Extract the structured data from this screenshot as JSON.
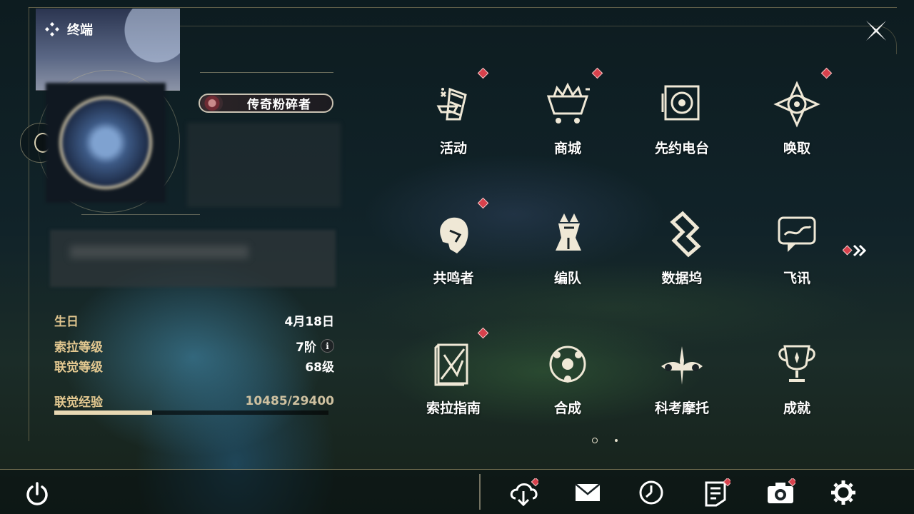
{
  "header": {
    "title": "终端"
  },
  "profile": {
    "title_badge": "传奇粉碎者",
    "stats": [
      {
        "label": "生日",
        "value": "4月18日"
      },
      {
        "label": "索拉等级",
        "value": "7阶"
      },
      {
        "label": "联觉等级",
        "value": "68级"
      }
    ],
    "exp": {
      "label": "联觉经验",
      "value": "10485/29400",
      "current": 10485,
      "max": 29400
    }
  },
  "menu": {
    "items": [
      {
        "label": "活动",
        "icon": "activity-icon",
        "badge": true
      },
      {
        "label": "商城",
        "icon": "shop-cart-icon",
        "badge": true
      },
      {
        "label": "先约电台",
        "icon": "radio-icon",
        "badge": false
      },
      {
        "label": "唤取",
        "icon": "summon-compass-icon",
        "badge": true
      },
      {
        "label": "共鸣者",
        "icon": "resonator-head-icon",
        "badge": true
      },
      {
        "label": "编队",
        "icon": "chess-formation-icon",
        "badge": false
      },
      {
        "label": "数据坞",
        "icon": "data-dock-icon",
        "badge": false
      },
      {
        "label": "飞讯",
        "icon": "message-bubble-icon",
        "badge": false
      },
      {
        "label": "索拉指南",
        "icon": "guide-book-icon",
        "badge": true
      },
      {
        "label": "合成",
        "icon": "synthesis-icon",
        "badge": false
      },
      {
        "label": "科考摩托",
        "icon": "motorcycle-icon",
        "badge": false
      },
      {
        "label": "成就",
        "icon": "trophy-icon",
        "badge": false
      }
    ],
    "pages": 2,
    "current_page": 1
  },
  "footer": {
    "icons": [
      {
        "icon": "download-cloud-icon",
        "badge": true
      },
      {
        "icon": "mail-icon",
        "badge": false
      },
      {
        "icon": "clock-icon",
        "badge": false
      },
      {
        "icon": "notice-icon",
        "badge": true
      },
      {
        "icon": "camera-icon",
        "badge": true
      },
      {
        "icon": "settings-gear-icon",
        "badge": false
      }
    ]
  },
  "colors": {
    "accent_gold": "#e3c890",
    "badge_red": "#d8414c",
    "text_white": "#ffffff"
  }
}
